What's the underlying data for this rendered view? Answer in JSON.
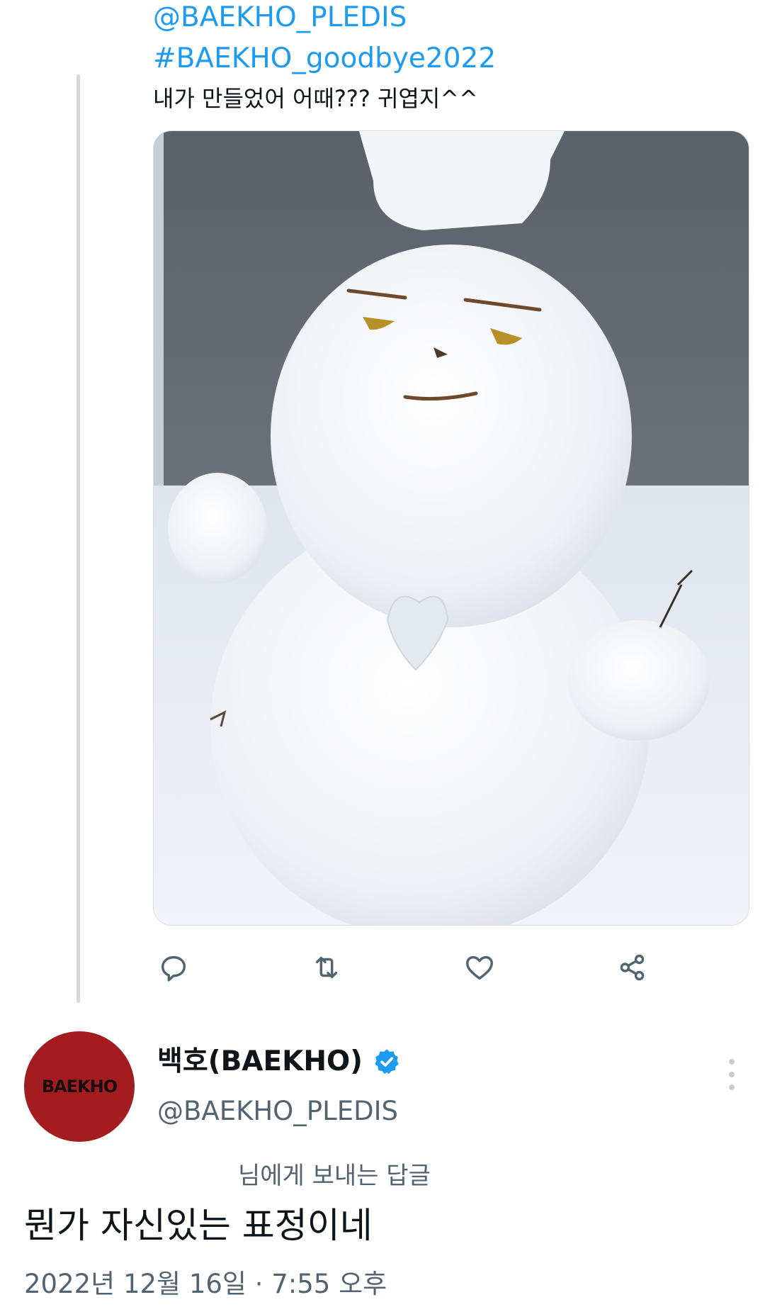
{
  "previous_tweet": {
    "mention": "@BAEKHO_PLEDIS",
    "hashtag": "#BAEKHO_goodbye2022",
    "text": "내가 만들었어 어때??? 귀엽지^^"
  },
  "actions": {
    "reply_icon": "reply-icon",
    "retweet_icon": "retweet-icon",
    "like_icon": "heart-icon",
    "share_icon": "share-icon"
  },
  "reply_tweet": {
    "avatar_text": "BAEKHO",
    "display_name": "백호(BAEKHO)",
    "handle": "@BAEKHO_PLEDIS",
    "reply_to_text": "님에게 보내는 답글",
    "text": "뭔가 자신있는 표정이네",
    "timestamp": "2022년 12월 16일 · 7:55 오후"
  },
  "colors": {
    "link": "#1d9bf0",
    "secondary_text": "#536471",
    "avatar_bg": "#a31c1f",
    "verified": "#1d9bf0"
  }
}
